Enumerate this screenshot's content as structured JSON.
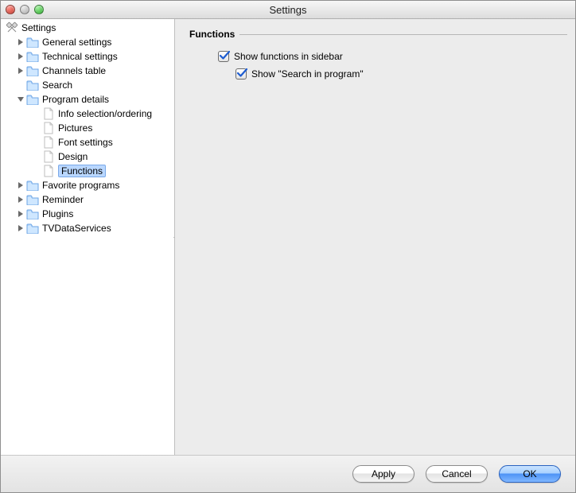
{
  "window": {
    "title": "Settings"
  },
  "tree": {
    "root_label": "Settings",
    "items": [
      {
        "label": "General settings"
      },
      {
        "label": "Technical settings"
      },
      {
        "label": "Channels table"
      },
      {
        "label": "Search"
      },
      {
        "label": "Program details",
        "expanded": true,
        "children": [
          {
            "label": "Info selection/ordering"
          },
          {
            "label": "Pictures"
          },
          {
            "label": "Font settings"
          },
          {
            "label": "Design"
          },
          {
            "label": "Functions",
            "selected": true
          }
        ]
      },
      {
        "label": "Favorite programs"
      },
      {
        "label": "Reminder"
      },
      {
        "label": "Plugins"
      },
      {
        "label": "TVDataServices"
      }
    ]
  },
  "panel": {
    "section_title": "Functions",
    "options": {
      "show_functions_in_sidebar": {
        "label": "Show functions in sidebar",
        "checked": true
      },
      "show_search_in_program": {
        "label": "Show \"Search in program\"",
        "checked": true
      }
    }
  },
  "buttons": {
    "apply": "Apply",
    "cancel": "Cancel",
    "ok": "OK"
  }
}
